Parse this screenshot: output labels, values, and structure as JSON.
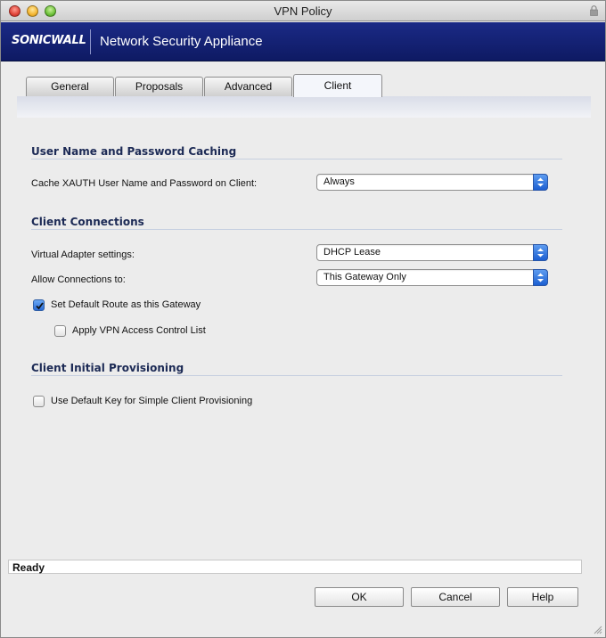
{
  "window": {
    "title": "VPN Policy"
  },
  "brand": {
    "logo": "SONICWALL",
    "product": "Network Security Appliance"
  },
  "tabs": [
    {
      "label": "General"
    },
    {
      "label": "Proposals"
    },
    {
      "label": "Advanced"
    },
    {
      "label": "Client",
      "active": true
    }
  ],
  "sections": {
    "caching": {
      "title": "User Name and Password Caching",
      "cache_label": "Cache XAUTH User Name and Password on Client:",
      "cache_value": "Always"
    },
    "connections": {
      "title": "Client Connections",
      "adapter_label": "Virtual Adapter settings:",
      "adapter_value": "DHCP Lease",
      "allow_label": "Allow Connections to:",
      "allow_value": "This Gateway Only",
      "default_route_label": "Set Default Route as this Gateway",
      "default_route_checked": true,
      "access_control_label": "Apply VPN Access Control List",
      "access_control_checked": false
    },
    "provisioning": {
      "title": "Client Initial Provisioning",
      "default_key_label": "Use Default Key for Simple Client Provisioning",
      "default_key_checked": false
    }
  },
  "status": {
    "text": "Ready"
  },
  "buttons": {
    "ok": "OK",
    "cancel": "Cancel",
    "help": "Help"
  },
  "colors": {
    "brand_bar": "#14237a",
    "section_title": "#1c2a55",
    "select_arrow": "#2a6bd6"
  }
}
